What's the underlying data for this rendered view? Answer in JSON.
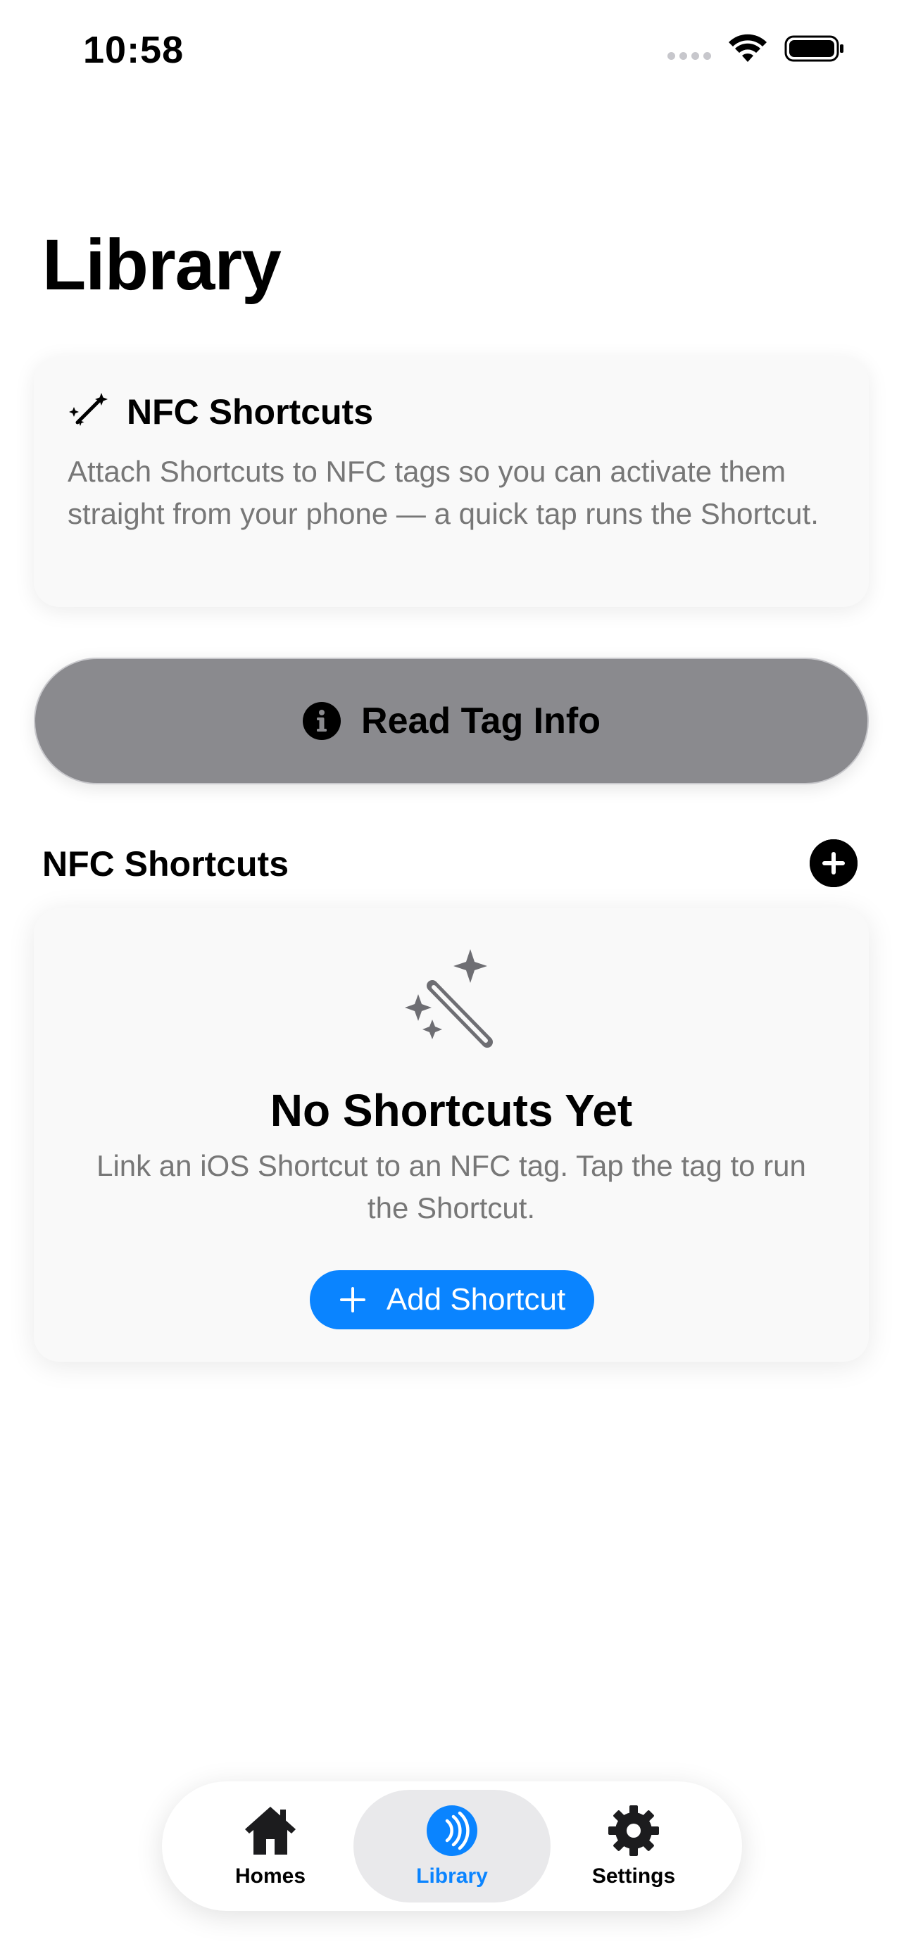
{
  "status_bar": {
    "time": "10:58",
    "icons": [
      "signal-dots-icon",
      "wifi-icon",
      "battery-icon"
    ]
  },
  "page": {
    "title": "Library"
  },
  "info_card": {
    "icon": "magic-wand-icon",
    "title": "NFC Shortcuts",
    "description": "Attach Shortcuts to NFC tags so you can activate them straight from your phone — a quick tap runs the Shortcut."
  },
  "read_tag_button": {
    "icon": "info-circle-icon",
    "label": "Read Tag Info"
  },
  "section": {
    "title": "NFC Shortcuts",
    "add_icon": "plus-circle-icon"
  },
  "empty_state": {
    "icon": "magic-wand-icon",
    "title": "No Shortcuts Yet",
    "description": "Link an iOS Shortcut to an NFC tag. Tap the tag to run the Shortcut.",
    "button_label": "Add Shortcut",
    "button_icon": "plus-icon"
  },
  "tab_bar": {
    "tabs": [
      {
        "label": "Homes",
        "icon": "house-icon",
        "selected": false
      },
      {
        "label": "Library",
        "icon": "nfc-wave-icon",
        "selected": true
      },
      {
        "label": "Settings",
        "icon": "gear-icon",
        "selected": false
      }
    ]
  },
  "colors": {
    "accent": "#0a84ff",
    "button_gray": "#8a8a8e",
    "secondary_text": "#777777",
    "card_background": "#f9f9f9"
  }
}
